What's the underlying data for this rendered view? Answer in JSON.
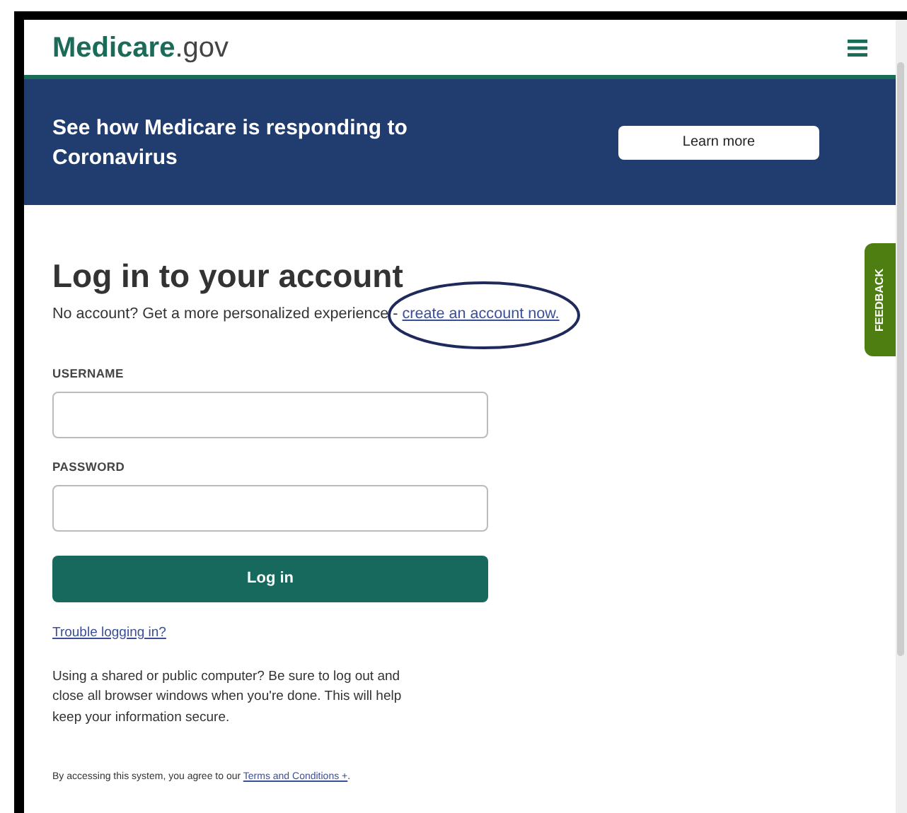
{
  "header": {
    "logo_main": "Medicare",
    "logo_suffix": ".gov"
  },
  "banner": {
    "text": "See how Medicare is responding to Coronavirus",
    "button": "Learn more"
  },
  "feedback_tab": "FEEDBACK",
  "login": {
    "title": "Log in to your account",
    "intro": "No account? Get a more personalized experience - ",
    "create_link": "create an account now.",
    "annotation": {
      "kind": "ellipse"
    },
    "fields": [
      {
        "label": "USERNAME"
      },
      {
        "label": "PASSWORD"
      }
    ],
    "submit": "Log in",
    "trouble_link": "Trouble logging in?",
    "notice": "Using a shared or public computer? Be sure to log out and close all browser windows when you're done. This will help keep your information secure.",
    "terms_intro": "By accessing this system, you agree to our ",
    "terms_link": "Terms and Conditions +",
    "terms_end": "."
  }
}
